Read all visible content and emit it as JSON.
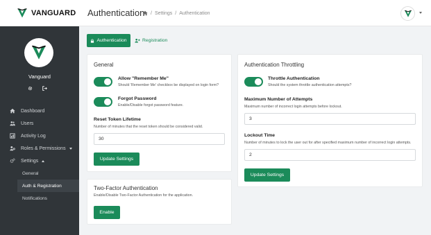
{
  "brand": {
    "name": "VANGUARD"
  },
  "header": {
    "title": "Authentication",
    "breadcrumb": [
      "Settings",
      "Authentication"
    ]
  },
  "colors": {
    "accent": "#1b8b5a",
    "sidebar_bg": "#303539",
    "page_bg": "#f1f3f5"
  },
  "sidebar": {
    "user_name": "Vanguard",
    "items": [
      {
        "label": "Dashboard",
        "icon": "home-icon"
      },
      {
        "label": "Users",
        "icon": "users-icon"
      },
      {
        "label": "Activity Log",
        "icon": "activity-log-icon"
      },
      {
        "label": "Roles & Permissions",
        "icon": "roles-icon"
      },
      {
        "label": "Settings",
        "icon": "gears-icon"
      }
    ],
    "settings_sub": [
      {
        "label": "General"
      },
      {
        "label": "Auth & Registration"
      },
      {
        "label": "Notifications"
      }
    ]
  },
  "tabs": {
    "authentication": "Authentication",
    "registration": "Registration"
  },
  "general_card": {
    "title": "General",
    "remember_me": {
      "title": "Allow \"Remember Me\"",
      "description": "Should 'Remember Me' checkbox be displayed on login form?",
      "enabled": true
    },
    "forgot_password": {
      "title": "Forgot Password",
      "description": "Enable/Disable forgot password feature.",
      "enabled": true
    },
    "reset_token": {
      "label": "Reset Token Lifetime",
      "help": "Number of minutes that the reset token should be considered valid.",
      "value": "30"
    },
    "button": "Update Settings"
  },
  "throttle_card": {
    "title": "Authentication Throttling",
    "throttle": {
      "title": "Throttle Authentication",
      "description": "Should the system throttle authentication attempts?",
      "enabled": true
    },
    "max_attempts": {
      "label": "Maximum Number of Attempts",
      "help": "Maximum number of incorrect login attempts before lockout.",
      "value": "3"
    },
    "lockout": {
      "label": "Lockout Time",
      "help": "Number of minutes to lock the user out for after specified maximum number of incorrect login attempts.",
      "value": "2"
    },
    "button": "Update Settings"
  },
  "two_factor_card": {
    "title": "Two-Factor Authentication",
    "description": "Enable/Disable Two-Factor Authentication for the application.",
    "button": "Enable"
  }
}
